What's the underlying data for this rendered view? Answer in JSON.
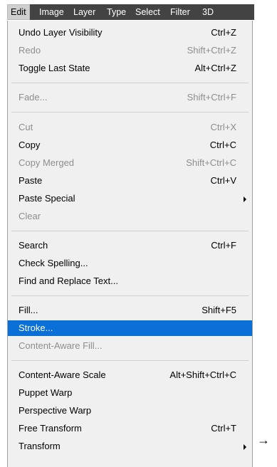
{
  "menubar": {
    "items": [
      {
        "label": "Edit",
        "active": true
      },
      {
        "label": "Image"
      },
      {
        "label": "Layer"
      },
      {
        "label": "Type"
      },
      {
        "label": "Select"
      },
      {
        "label": "Filter"
      },
      {
        "label": "3D"
      }
    ]
  },
  "edit_menu": {
    "items": [
      {
        "label": "Undo Layer Visibility",
        "shortcut": "Ctrl+Z"
      },
      {
        "label": "Redo",
        "shortcut": "Shift+Ctrl+Z",
        "disabled": true
      },
      {
        "label": "Toggle Last State",
        "shortcut": "Alt+Ctrl+Z"
      },
      {
        "label": "Fade...",
        "shortcut": "Shift+Ctrl+F",
        "disabled": true
      },
      {
        "label": "Cut",
        "shortcut": "Ctrl+X",
        "disabled": true
      },
      {
        "label": "Copy",
        "shortcut": "Ctrl+C"
      },
      {
        "label": "Copy Merged",
        "shortcut": "Shift+Ctrl+C",
        "disabled": true
      },
      {
        "label": "Paste",
        "shortcut": "Ctrl+V"
      },
      {
        "label": "Paste Special",
        "submenu": true
      },
      {
        "label": "Clear",
        "disabled": true
      },
      {
        "label": "Search",
        "shortcut": "Ctrl+F"
      },
      {
        "label": "Check Spelling..."
      },
      {
        "label": "Find and Replace Text..."
      },
      {
        "label": "Fill...",
        "shortcut": "Shift+F5"
      },
      {
        "label": "Stroke...",
        "highlighted": true
      },
      {
        "label": "Content-Aware Fill...",
        "disabled": true
      },
      {
        "label": "Content-Aware Scale",
        "shortcut": "Alt+Shift+Ctrl+C"
      },
      {
        "label": "Puppet Warp"
      },
      {
        "label": "Perspective Warp"
      },
      {
        "label": "Free Transform",
        "shortcut": "Ctrl+T"
      },
      {
        "label": "Transform",
        "submenu": true
      }
    ]
  },
  "annotation": {
    "arrow": "→"
  },
  "colors": {
    "menubar_bg": "#434343",
    "menu_bg": "#f0f0f0",
    "highlight": "#0a6fd6",
    "disabled_text": "#8e8e8e"
  }
}
